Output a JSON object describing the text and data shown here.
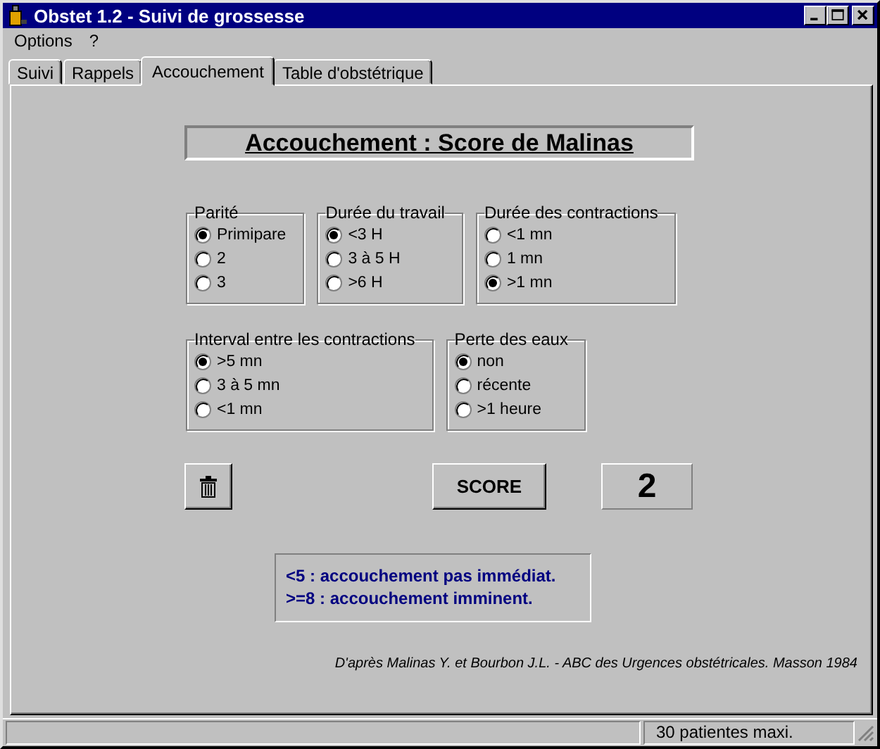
{
  "window": {
    "title": "Obstet 1.2 - Suivi de grossesse"
  },
  "menu": [
    {
      "label": "Options"
    },
    {
      "label": "?"
    }
  ],
  "tabs": [
    {
      "label": "Suivi",
      "selected": false
    },
    {
      "label": "Rappels",
      "selected": false
    },
    {
      "label": "Accouchement",
      "selected": true
    },
    {
      "label": "Table d'obstétrique",
      "selected": false
    }
  ],
  "heading": "Accouchement : Score de Malinas",
  "group_rows": [
    [
      {
        "title": "Parité",
        "options": [
          {
            "label": "Primipare",
            "selected": true
          },
          {
            "label": "2",
            "selected": false
          },
          {
            "label": "3",
            "selected": false
          }
        ]
      },
      {
        "title": "Durée du travail",
        "options": [
          {
            "label": "<3 H",
            "selected": true
          },
          {
            "label": "3 à 5 H",
            "selected": false
          },
          {
            "label": ">6 H",
            "selected": false
          }
        ]
      },
      {
        "title": "Durée des contractions",
        "options": [
          {
            "label": "<1 mn",
            "selected": false
          },
          {
            "label": "1 mn",
            "selected": false
          },
          {
            "label": ">1 mn",
            "selected": true
          }
        ]
      }
    ],
    [
      {
        "title": "Interval entre les contractions",
        "options": [
          {
            "label": ">5 mn",
            "selected": true
          },
          {
            "label": "3 à 5 mn",
            "selected": false
          },
          {
            "label": "<1 mn",
            "selected": false
          }
        ]
      },
      {
        "title": "Perte des eaux",
        "options": [
          {
            "label": "non",
            "selected": true
          },
          {
            "label": "récente",
            "selected": false
          },
          {
            "label": ">1 heure",
            "selected": false
          }
        ]
      }
    ]
  ],
  "score_button": "SCORE",
  "score": "2",
  "legend": [
    "<5 : accouchement pas immédiat.",
    ">=8 : accouchement imminent."
  ],
  "reference": "D'après Malinas Y. et Bourbon J.L. -  ABC des Urgences obstétricales. Masson 1984",
  "status_bar": {
    "text": "30 patientes maxi."
  }
}
